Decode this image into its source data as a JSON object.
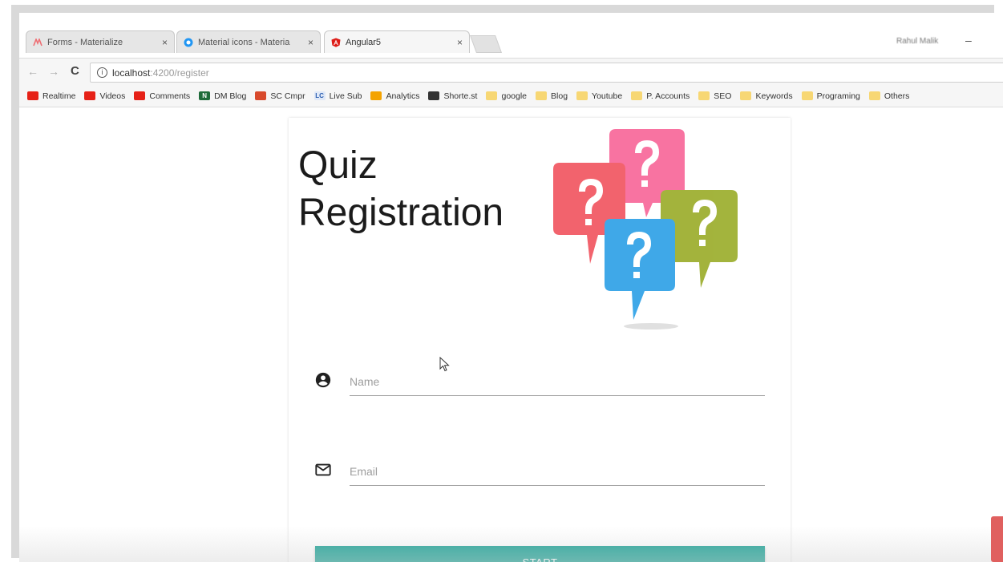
{
  "tabs": [
    {
      "label": "Forms - Materialize",
      "close": "×"
    },
    {
      "label": "Material icons - Materia",
      "close": "×"
    },
    {
      "label": "Angular5",
      "close": "×"
    }
  ],
  "profile_name": "Rahul Malik",
  "minimize_glyph": "–",
  "nav": {
    "back": "←",
    "forward": "→",
    "reload": "C",
    "info": "i"
  },
  "url": {
    "host": "localhost",
    "path": ":4200/register"
  },
  "bookmarks": [
    {
      "label": "Realtime",
      "color": "#e62117"
    },
    {
      "label": "Videos",
      "color": "#e62117"
    },
    {
      "label": "Comments",
      "color": "#e62117"
    },
    {
      "label": "DM Blog",
      "color": "#1e6b3a",
      "glyph": "N"
    },
    {
      "label": "SC Cmpr",
      "color": "#d84a2c"
    },
    {
      "label": "Live Sub",
      "color": "#dfe8f7",
      "glyph": "LC"
    },
    {
      "label": "Analytics",
      "color": "#f4a300"
    },
    {
      "label": "Shorte.st",
      "color": "#333333"
    },
    {
      "label": "google",
      "color": "#f7d774"
    },
    {
      "label": "Blog",
      "color": "#f7d774"
    },
    {
      "label": "Youtube",
      "color": "#f7d774"
    },
    {
      "label": "P. Accounts",
      "color": "#f7d774"
    },
    {
      "label": "SEO",
      "color": "#f7d774"
    },
    {
      "label": "Keywords",
      "color": "#f7d774"
    },
    {
      "label": "Programing",
      "color": "#f7d774"
    },
    {
      "label": "Others",
      "color": "#f7d774"
    }
  ],
  "page": {
    "title_line1": "Quiz",
    "title_line2": "Registration",
    "name_placeholder": "Name",
    "email_placeholder": "Email",
    "start_label": "START",
    "accent_color": "#26a69a"
  }
}
